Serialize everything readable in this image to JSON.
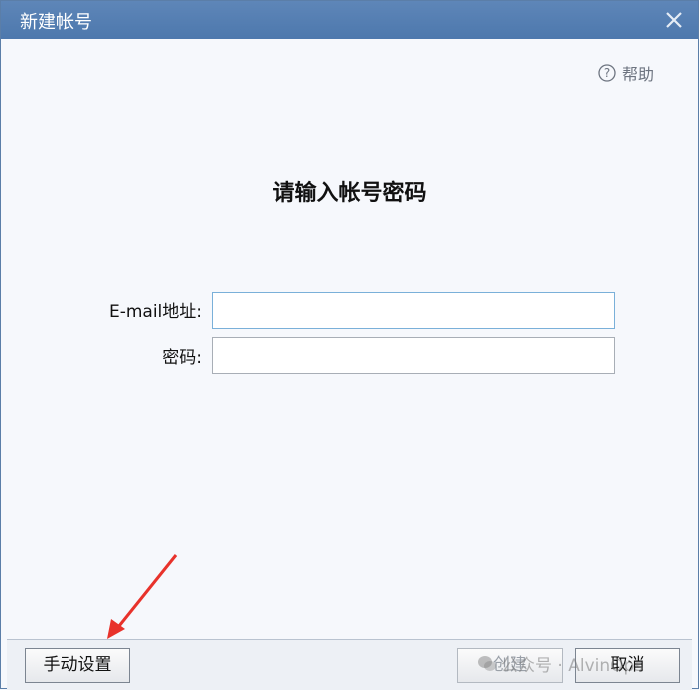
{
  "window": {
    "title": "新建帐号"
  },
  "help": {
    "label": "帮助",
    "icon": "question-circle-icon"
  },
  "heading": "请输入帐号密码",
  "form": {
    "email_label": "E-mail地址:",
    "email_value": "",
    "password_label": "密码:",
    "password_value": ""
  },
  "buttons": {
    "manual_setup": "手动设置",
    "create": "创建",
    "cancel": "取消"
  },
  "watermark": {
    "text": "公众号 · AlvinOps",
    "icon": "wechat-icon"
  },
  "colors": {
    "titlebar": "#5e86b8",
    "background": "#f6f8fc",
    "annotation_arrow": "#e8322b"
  }
}
